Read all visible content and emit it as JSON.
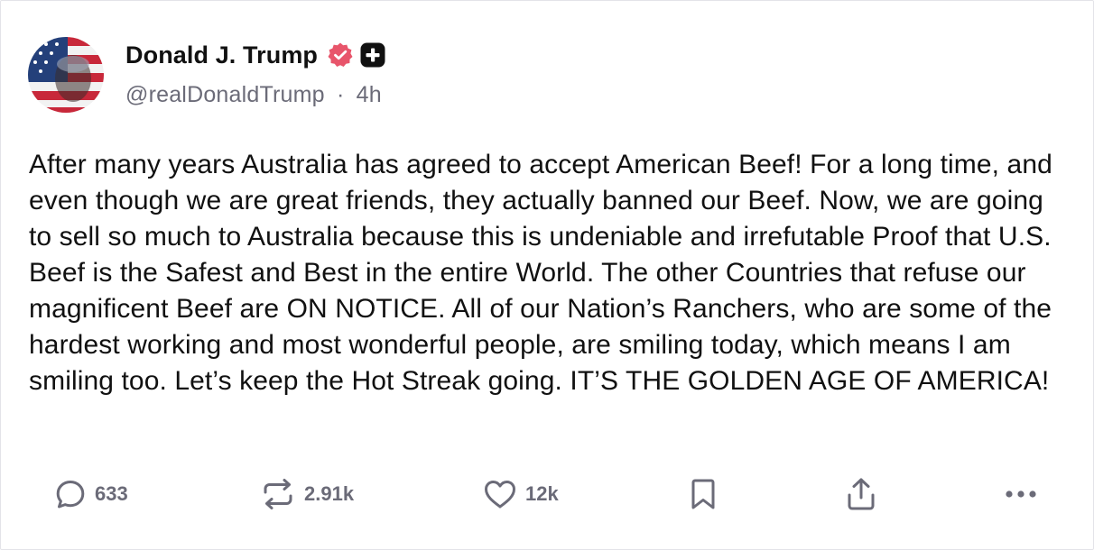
{
  "post": {
    "author": {
      "display_name": "Donald J. Trump",
      "handle": "@realDonaldTrump",
      "separator": "·",
      "time_ago": "4h",
      "avatar_icon": "avatar-flag-portrait"
    },
    "badges": {
      "verified_icon": "verified-badge-icon",
      "verified_color": "#e8556b",
      "plus_icon": "plus-badge-icon"
    },
    "text": "After many years Australia has agreed to accept American Beef! For a long time, and even though we are great friends, they actually banned our Beef. Now, we are going to sell so much to Australia because this is undeniable and irrefutable Proof that U.S. Beef is the Safest and Best in the entire World. The other Countries that refuse our magnificent Beef are ON NOTICE. All of our Nation’s Ranchers, who are some of the hardest working and most wonderful people, are smiling today, which means I am smiling too. Let’s keep the Hot Streak going. IT’S THE GOLDEN AGE OF AMERICA!",
    "actions": {
      "reply": {
        "icon": "reply-icon",
        "count": "633"
      },
      "retruth": {
        "icon": "retruth-icon",
        "count": "2.91k"
      },
      "like": {
        "icon": "heart-icon",
        "count": "12k"
      },
      "bookmark": {
        "icon": "bookmark-icon"
      },
      "share": {
        "icon": "share-icon"
      },
      "more": {
        "icon": "more-icon"
      }
    }
  },
  "colors": {
    "text": "#111111",
    "muted": "#6b6b78",
    "border": "#e3e3e8"
  }
}
